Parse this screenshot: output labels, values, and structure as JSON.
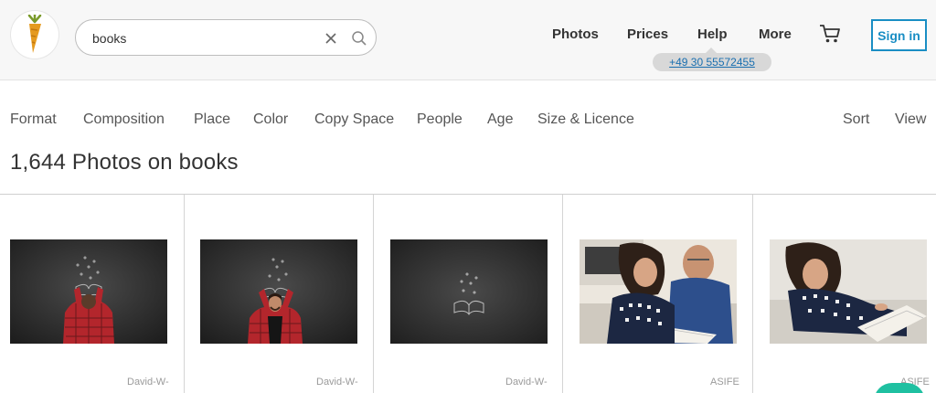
{
  "header": {
    "search": {
      "value": "books",
      "placeholder": ""
    },
    "nav": {
      "photos": "Photos",
      "prices": "Prices",
      "help": "Help",
      "more": "More"
    },
    "signin_label": "Sign in",
    "phone": "+49 30 55572455"
  },
  "filters": {
    "format": "Format",
    "composition": "Composition",
    "place": "Place",
    "color": "Color",
    "copy_space": "Copy Space",
    "people": "People",
    "age": "Age",
    "size_licence": "Size & Licence",
    "sort": "Sort",
    "view": "View"
  },
  "results": {
    "title": "1,644 Photos on books",
    "items": [
      {
        "credit": "David-W-"
      },
      {
        "credit": "David-W-"
      },
      {
        "credit": "David-W-"
      },
      {
        "credit": "ASIFE"
      },
      {
        "credit": "ASIFE"
      }
    ]
  },
  "colors": {
    "accent": "#1a8ec4",
    "chat": "#1fc0a1",
    "header_bg": "#f7f7f7"
  }
}
